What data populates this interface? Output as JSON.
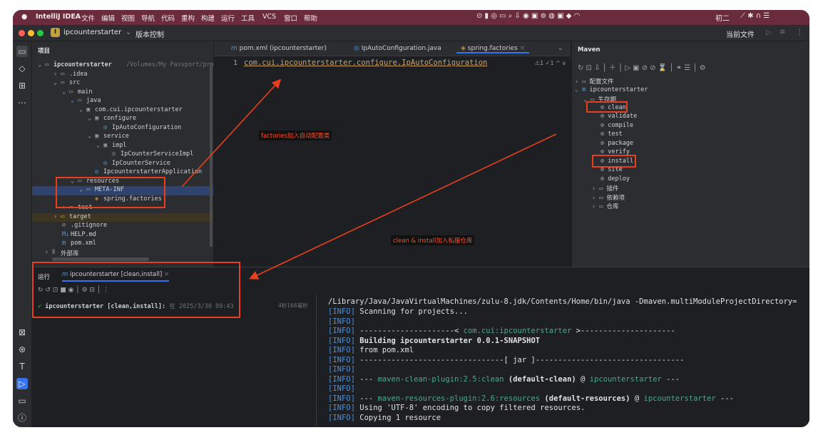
{
  "menubar": {
    "apple": "",
    "items": [
      "IntelliJ IDEA",
      "文件",
      "编辑",
      "视图",
      "导航",
      "代码",
      "重构",
      "构建",
      "运行",
      "工具",
      "VCS",
      "窗口",
      "帮助"
    ],
    "tray_date": "初二"
  },
  "titlebar": {
    "project_badge": "I",
    "project": "ipcounterstarter",
    "vcs": "版本控制",
    "current_file": "当前文件"
  },
  "project_panel": {
    "header": "项目",
    "rows": [
      {
        "label": "ipcounterstarter",
        "extra": "/Volumes/My Passport/proj"
      },
      {
        "label": ".idea"
      },
      {
        "label": "src"
      },
      {
        "label": "main"
      },
      {
        "label": "java"
      },
      {
        "label": "com.cui.ipcounterstarter"
      },
      {
        "label": "configure"
      },
      {
        "label": "IpAutoConfiguration"
      },
      {
        "label": "service"
      },
      {
        "label": "impl"
      },
      {
        "label": "IpCounterServiceImpl"
      },
      {
        "label": "IpCounterService"
      },
      {
        "label": "IpcounterstarterApplication"
      },
      {
        "label": "resources"
      },
      {
        "label": "META-INF"
      },
      {
        "label": "spring.factories"
      },
      {
        "label": "test"
      },
      {
        "label": "target"
      },
      {
        "label": ".gitignore"
      },
      {
        "label": "HELP.md"
      },
      {
        "label": "pom.xml"
      },
      {
        "label": "外部库"
      }
    ]
  },
  "editor": {
    "tabs": [
      "pom.xml (ipcounterstarter)",
      "IpAutoConfiguration.java",
      "spring.factories"
    ],
    "line_number": "1",
    "code": "com.cui.ipcounterstarter.configure.IpAutoConfiguration",
    "inspection": "⚠1 ✓1 ^ v"
  },
  "maven": {
    "title": "Maven",
    "rows": [
      {
        "label": "配置文件"
      },
      {
        "label": "ipcounterstarter"
      },
      {
        "label": "生存期"
      },
      {
        "label": "clean"
      },
      {
        "label": "validate"
      },
      {
        "label": "compile"
      },
      {
        "label": "test"
      },
      {
        "label": "package"
      },
      {
        "label": "verify"
      },
      {
        "label": "install"
      },
      {
        "label": "site"
      },
      {
        "label": "deploy"
      },
      {
        "label": "插件"
      },
      {
        "label": "依赖项"
      },
      {
        "label": "仓库"
      }
    ]
  },
  "run_panel": {
    "title": "运行",
    "tab": "ipcounterstarter [clean,install]",
    "tree_item": "ipcounterstarter [clean,install]:",
    "tree_time": "在 2025/3/30 09:43",
    "duration": "4秒166毫秒",
    "console": [
      "/Library/Java/JavaVirtualMachines/zulu-8.jdk/Contents/Home/bin/java -Dmaven.multiModuleProjectDirectory=",
      "[INFO] Scanning for projects...",
      "[INFO]",
      "[INFO] ---------------------< com.cui:ipcounterstarter >---------------------",
      "[INFO] Building ipcounterstarter 0.0.1-SNAPSHOT",
      "[INFO]   from pom.xml",
      "[INFO] --------------------------------[ jar ]---------------------------------",
      "[INFO]",
      "[INFO] --- maven-clean-plugin:2.5:clean (default-clean) @ ipcounterstarter ---",
      "[INFO]",
      "[INFO] --- maven-resources-plugin:2.6:resources (default-resources) @ ipcounterstarter ---",
      "[INFO] Using 'UTF-8' encoding to copy filtered resources.",
      "[INFO] Copying 1 resource"
    ]
  },
  "annotations": {
    "factories_note": "factories加入自动配置类",
    "install_note": "clean & install加入私服仓库",
    "color": "#e8401c"
  }
}
